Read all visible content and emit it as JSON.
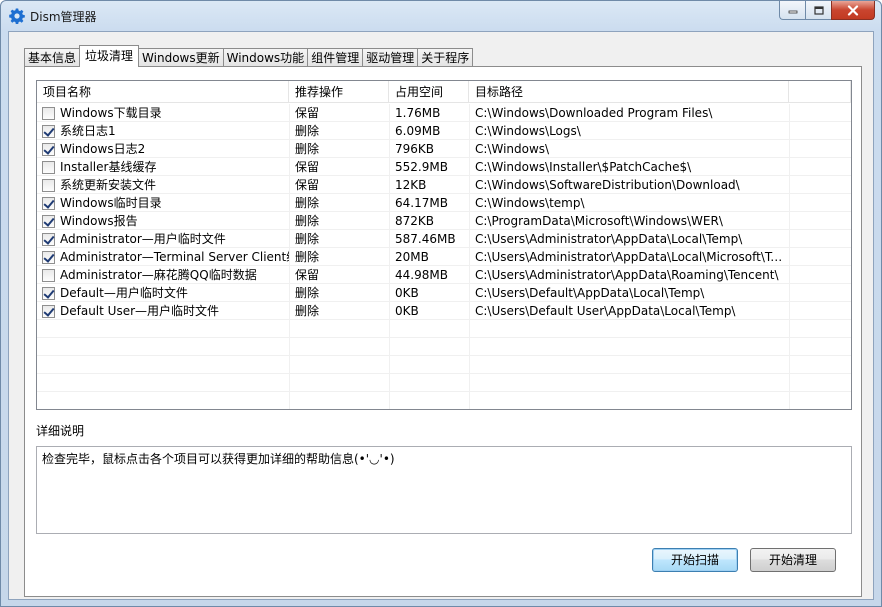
{
  "window": {
    "title": "Dism管理器",
    "accent": "#1e6fd1"
  },
  "tabs": [
    {
      "label": "基本信息",
      "active": false
    },
    {
      "label": "垃圾清理",
      "active": true
    },
    {
      "label": "Windows更新",
      "active": false
    },
    {
      "label": "Windows功能",
      "active": false
    },
    {
      "label": "组件管理",
      "active": false
    },
    {
      "label": "驱动管理",
      "active": false
    },
    {
      "label": "关于程序",
      "active": false
    }
  ],
  "list": {
    "columns": [
      "项目名称",
      "推荐操作",
      "占用空间",
      "目标路径"
    ],
    "rows": [
      {
        "checked": false,
        "name": "Windows下载目录",
        "action": "保留",
        "size": "1.76MB",
        "path": "C:\\Windows\\Downloaded Program Files\\"
      },
      {
        "checked": true,
        "name": "系统日志1",
        "action": "删除",
        "size": "6.09MB",
        "path": "C:\\Windows\\Logs\\"
      },
      {
        "checked": true,
        "name": "Windows日志2",
        "action": "删除",
        "size": "796KB",
        "path": "C:\\Windows\\"
      },
      {
        "checked": false,
        "name": "Installer基线缓存",
        "action": "保留",
        "size": "552.9MB",
        "path": "C:\\Windows\\Installer\\$PatchCache$\\"
      },
      {
        "checked": false,
        "name": "系统更新安装文件",
        "action": "保留",
        "size": "12KB",
        "path": "C:\\Windows\\SoftwareDistribution\\Download\\"
      },
      {
        "checked": true,
        "name": "Windows临时目录",
        "action": "删除",
        "size": "64.17MB",
        "path": "C:\\Windows\\temp\\"
      },
      {
        "checked": true,
        "name": "Windows报告",
        "action": "删除",
        "size": "872KB",
        "path": "C:\\ProgramData\\Microsoft\\Windows\\WER\\"
      },
      {
        "checked": true,
        "name": "Administrator—用户临时文件",
        "action": "删除",
        "size": "587.46MB",
        "path": "C:\\Users\\Administrator\\AppData\\Local\\Temp\\"
      },
      {
        "checked": true,
        "name": "Administrator—Terminal Server Client缓存",
        "action": "删除",
        "size": "20MB",
        "path": "C:\\Users\\Administrator\\AppData\\Local\\Microsoft\\Termi..."
      },
      {
        "checked": false,
        "name": "Administrator—麻花腾QQ临时数据",
        "action": "保留",
        "size": "44.98MB",
        "path": "C:\\Users\\Administrator\\AppData\\Roaming\\Tencent\\"
      },
      {
        "checked": true,
        "name": "Default—用户临时文件",
        "action": "删除",
        "size": "0KB",
        "path": "C:\\Users\\Default\\AppData\\Local\\Temp\\"
      },
      {
        "checked": true,
        "name": "Default User—用户临时文件",
        "action": "删除",
        "size": "0KB",
        "path": "C:\\Users\\Default User\\AppData\\Local\\Temp\\"
      }
    ]
  },
  "detail": {
    "label": "详细说明",
    "text": "检查完毕，鼠标点击各个项目可以获得更加详细的帮助信息(•'◡'•)"
  },
  "buttons": {
    "scan": "开始扫描",
    "clean": "开始清理"
  }
}
